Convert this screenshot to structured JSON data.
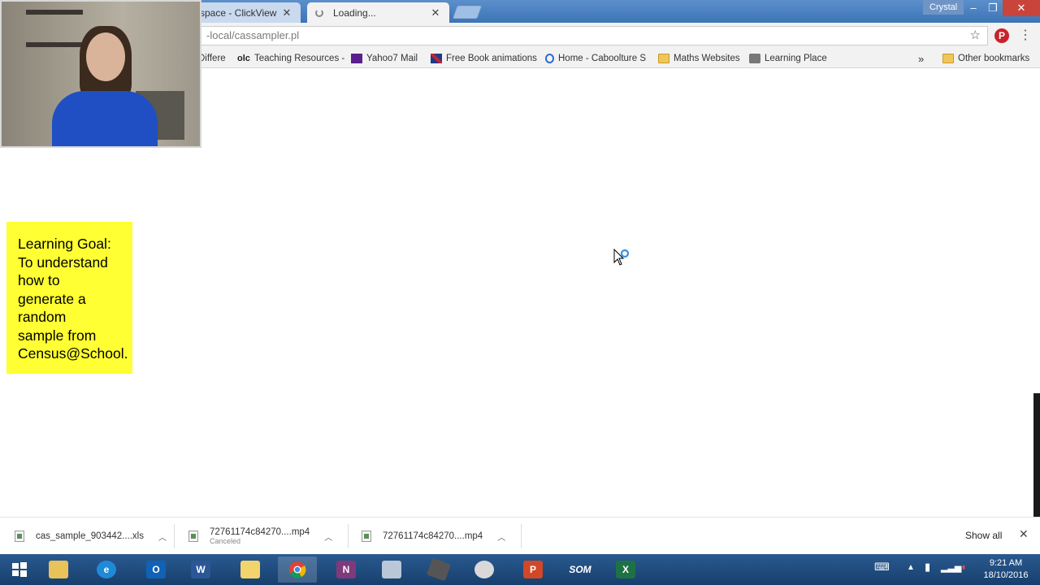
{
  "browser": {
    "profile_name": "Crystal",
    "tabs": [
      {
        "label": "space - ClickView",
        "state": "inactive"
      },
      {
        "label": "Loading...",
        "state": "active"
      }
    ],
    "address": "-local/cassampler.pl",
    "bookmarks": [
      {
        "label": "Differe",
        "icon": "none"
      },
      {
        "label": "Teaching Resources -",
        "icon": "olc-icon",
        "glyph": "olc"
      },
      {
        "label": "Yahoo7 Mail",
        "icon": "yahoo-mail-icon"
      },
      {
        "label": "Free Book animations",
        "icon": "uk-flag-icon"
      },
      {
        "label": "Home - Caboolture S",
        "icon": "home-site-icon"
      },
      {
        "label": "Maths Websites",
        "icon": "folder-icon"
      },
      {
        "label": "Learning Place",
        "icon": "learning-place-icon"
      }
    ],
    "overflow_glyph": "»",
    "other_bookmarks": "Other bookmarks"
  },
  "learning_goal": "Learning Goal:\nTo understand\nhow to\ngenerate a\nrandom\nsample from\nCensus@School.",
  "downloads": {
    "items": [
      {
        "name": "cas_sample_903442....xls",
        "status": ""
      },
      {
        "name": "72761174c84270....mp4",
        "status": "Canceled"
      },
      {
        "name": "72761174c84270....mp4",
        "status": ""
      }
    ],
    "show_all": "Show all"
  },
  "taskbar": {
    "apps": [
      {
        "name": "windows-start-icon",
        "glyph": ""
      },
      {
        "name": "file-explorer-icon",
        "glyph": ""
      },
      {
        "name": "internet-explorer-icon",
        "glyph": "e"
      },
      {
        "name": "outlook-icon",
        "glyph": "O"
      },
      {
        "name": "word-icon",
        "glyph": "W"
      },
      {
        "name": "folder-icon",
        "glyph": ""
      },
      {
        "name": "chrome-icon",
        "glyph": ""
      },
      {
        "name": "onenote-icon",
        "glyph": "N"
      },
      {
        "name": "calculator-icon",
        "glyph": ""
      },
      {
        "name": "graphics-calculator-icon",
        "glyph": ""
      },
      {
        "name": "snipping-tool-icon",
        "glyph": ""
      },
      {
        "name": "powerpoint-icon",
        "glyph": "P"
      },
      {
        "name": "som-app-icon",
        "glyph": "SOM"
      },
      {
        "name": "excel-icon",
        "glyph": "X"
      }
    ],
    "time": "9:21 AM",
    "date": "18/10/2016"
  },
  "colors": {
    "goal_bg": "#ffff33",
    "tabstrip": "#3c74b5",
    "taskbar": "#1d4a7e"
  }
}
